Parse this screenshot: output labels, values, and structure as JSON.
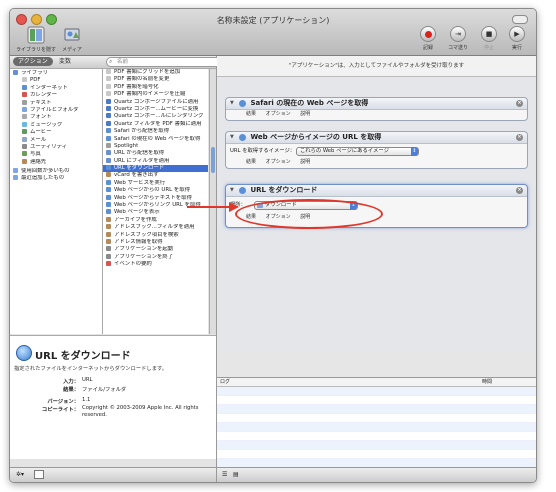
{
  "window": {
    "title": "名称未設定 (アプリケーション)"
  },
  "toolbar": {
    "library_label": "ライブラリを隠す",
    "media_label": "メディア",
    "record_label": "記録",
    "step_label": "コマ送り",
    "stop_label": "停止",
    "run_label": "実行"
  },
  "tabs": {
    "actions": "アクション",
    "variables": "変数"
  },
  "search": {
    "placeholder": "名前"
  },
  "library": [
    {
      "label": "ライブラリ",
      "indent": 0,
      "icon": "library-icon",
      "color": "#6a8fd0"
    },
    {
      "label": "PDF",
      "indent": 1,
      "icon": "pdf-icon",
      "color": "#c8c8c8"
    },
    {
      "label": "インターネット",
      "indent": 1,
      "icon": "globe-icon",
      "color": "#5b8fd6"
    },
    {
      "label": "カレンダー",
      "indent": 1,
      "icon": "calendar-icon",
      "color": "#d9534f"
    },
    {
      "label": "テキスト",
      "indent": 1,
      "icon": "text-icon",
      "color": "#9e9e9e"
    },
    {
      "label": "ファイルとフォルダ",
      "indent": 1,
      "icon": "finder-icon",
      "color": "#7fa6e0"
    },
    {
      "label": "フォント",
      "indent": 1,
      "icon": "font-icon",
      "color": "#aaaaaa"
    },
    {
      "label": "ミュージック",
      "indent": 1,
      "icon": "music-icon",
      "color": "#6cb9e0"
    },
    {
      "label": "ムービー",
      "indent": 1,
      "icon": "movie-icon",
      "color": "#5e9c5e"
    },
    {
      "label": "メール",
      "indent": 1,
      "icon": "mail-icon",
      "color": "#8fa8c8"
    },
    {
      "label": "ユーティリティ",
      "indent": 1,
      "icon": "utility-icon",
      "color": "#8a8a8a"
    },
    {
      "label": "写真",
      "indent": 1,
      "icon": "photo-icon",
      "color": "#6d9f5a"
    },
    {
      "label": "連絡先",
      "indent": 1,
      "icon": "contacts-icon",
      "color": "#b58a5a"
    },
    {
      "label": "使用回数が多いもの",
      "indent": 0,
      "icon": "folder-icon",
      "color": "#7fa6e0"
    },
    {
      "label": "最近追加したもの",
      "indent": 0,
      "icon": "folder-icon",
      "color": "#7fa6e0"
    }
  ],
  "actions": [
    {
      "label": "PDF 書類にグリッドを追加",
      "color": "#c8c8c8"
    },
    {
      "label": "PDF 書類の名前を変更",
      "color": "#c8c8c8"
    },
    {
      "label": "PDF 書類を暗号化",
      "color": "#c8c8c8"
    },
    {
      "label": "PDF 書類内のイメージを圧縮",
      "color": "#c8c8c8"
    },
    {
      "label": "Quartz コンポージファイルに適用",
      "color": "#4a7ac8"
    },
    {
      "label": "Quartz コンポー...ムービーに変換",
      "color": "#4a7ac8"
    },
    {
      "label": "Quartz コンポー...ルにレンダリング",
      "color": "#4a7ac8"
    },
    {
      "label": "Quartz フィルタを PDF 書類に適用",
      "color": "#4a7ac8"
    },
    {
      "label": "Safari から配信を取得",
      "color": "#5b8fd6"
    },
    {
      "label": "Safari の現在の Web ページを取得",
      "color": "#5b8fd6"
    },
    {
      "label": "Spotlight",
      "color": "#9e9e9e"
    },
    {
      "label": "URL から配信を取得",
      "color": "#6a8fd0"
    },
    {
      "label": "URL にフィルタを適用",
      "color": "#6a8fd0"
    },
    {
      "label": "URL をダウンロード",
      "color": "#5b8fd6",
      "selected": true
    },
    {
      "label": "vCard を書き出す",
      "color": "#b58a5a"
    },
    {
      "label": "Web サービスを実行",
      "color": "#5b8fd6"
    },
    {
      "label": "Web ページからの URL を取得",
      "color": "#5b8fd6"
    },
    {
      "label": "Web ページからテキストを取得",
      "color": "#5b8fd6"
    },
    {
      "label": "Web ページからリンク URL を取得",
      "color": "#5b8fd6"
    },
    {
      "label": "Web ページを表示",
      "color": "#5b8fd6"
    },
    {
      "label": "アーカイブを作成",
      "color": "#b58a5a"
    },
    {
      "label": "アドレスブック...フィルタを適用",
      "color": "#b58a5a"
    },
    {
      "label": "アドレスブック項目を検索",
      "color": "#b58a5a"
    },
    {
      "label": "アドレス情報を取得",
      "color": "#b58a5a"
    },
    {
      "label": "アプリケーションを起動",
      "color": "#8a8a8a"
    },
    {
      "label": "アプリケーションを終了",
      "color": "#8a8a8a"
    },
    {
      "label": "イベントの要約",
      "color": "#d9534f"
    }
  ],
  "description": {
    "title": "URL をダウンロード",
    "summary": "指定されたファイルをインターネットからダウンロードします。",
    "input_label": "入力：",
    "input_value": "URL",
    "result_label": "結果：",
    "result_value": "ファイル/フォルダ",
    "version_label": "バージョン：",
    "version_value": "1.1",
    "copyright_label": "コピーライト：",
    "copyright_value": "Copyright © 2003-2009 Apple Inc. All rights reserved."
  },
  "workflow": {
    "banner": "\"アプリケーション\"は、入力としてファイルやフォルダを受け取ります",
    "actions": [
      {
        "title": "Safari の現在の Web ページを取得"
      },
      {
        "title": "Web ページからイメージの URL を取得",
        "field_label": "URL を取得するイメージ：",
        "field_value": "これらの Web ページにあるイメージ"
      },
      {
        "title": "URL をダウンロード",
        "field_label": "場所：",
        "field_value": "ダウンロード"
      }
    ],
    "footer_results": "結果",
    "footer_options": "オプション",
    "footer_description": "説明"
  },
  "log": {
    "col_log": "ログ",
    "col_time": "時間"
  },
  "colors": {
    "record": "#d8231d",
    "selection": "#3f6fd1",
    "annotation": "#e0372b"
  }
}
